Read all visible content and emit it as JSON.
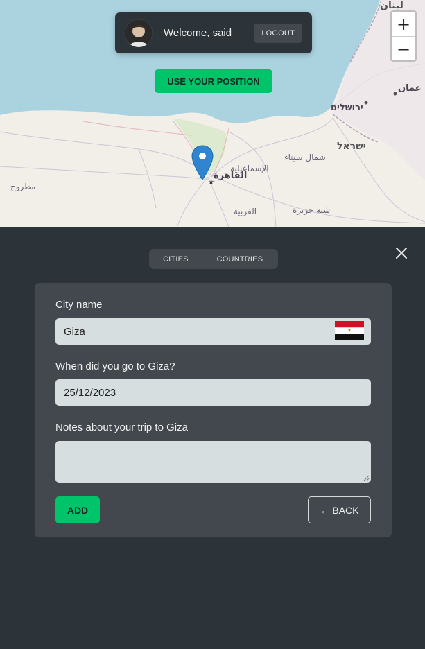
{
  "map": {
    "labels": {
      "lebanon": "لبنان",
      "amman": "عمان",
      "jerusalem": "ירושלים",
      "israel": "ישראל",
      "north_sinai": "شمال سيناء",
      "ismailia": "الإسماعيلية",
      "cairo": "القاهرة",
      "matrouh": "مطروح",
      "sinai_peninsula": "شبه جزيرة",
      "gharbia": "الفربية"
    },
    "zoom_in": "+",
    "zoom_out": "−"
  },
  "user_bar": {
    "welcome": "Welcome, said",
    "logout": "LOGOUT"
  },
  "use_position": "USE YOUR POSITION",
  "tabs": {
    "cities": "CITIES",
    "countries": "COUNTRIES"
  },
  "form": {
    "city_label": "City name",
    "city_value": "Giza",
    "date_label": "When did you go to Giza?",
    "date_value": "25/12/2023",
    "notes_label": "Notes about your trip to Giza",
    "notes_value": "",
    "add": "ADD",
    "back": "← BACK"
  },
  "colors": {
    "accent": "#00c46a",
    "panel_bg": "#2d3439",
    "card_bg": "#42484e",
    "field_bg": "#d6dee0",
    "sea": "#aad3df"
  },
  "icons": {
    "marker": "map-marker-icon",
    "close": "close-icon",
    "flag": "egypt-flag-icon"
  }
}
